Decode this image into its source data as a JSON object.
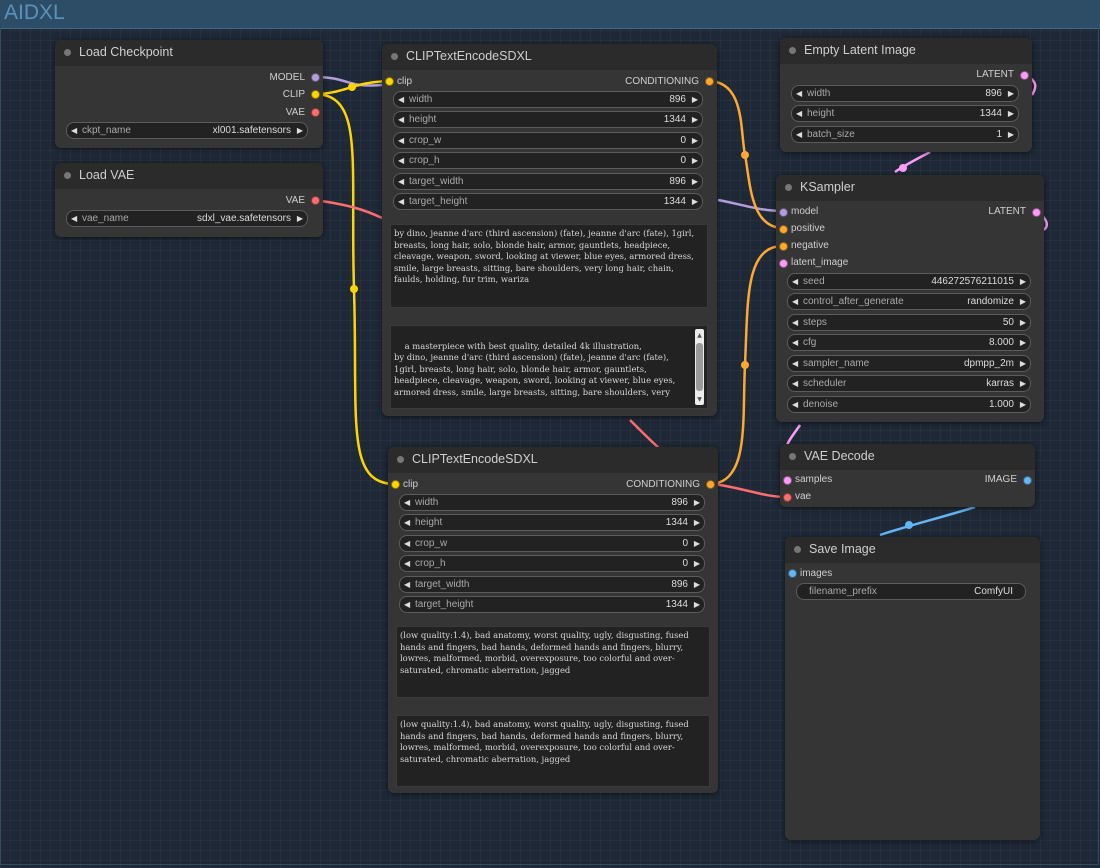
{
  "group": {
    "title": "AIDXL"
  },
  "colors": {
    "model": "#b39ddb",
    "clip": "#ffd500",
    "vae": "#ff6e6e",
    "conditioning": "#ffa931",
    "latent": "#ff9cf9",
    "image": "#64b5f6"
  },
  "load_checkpoint": {
    "title": "Load Checkpoint",
    "outputs": [
      "MODEL",
      "CLIP",
      "VAE"
    ],
    "widgets": [
      {
        "name": "ckpt_name",
        "value": "xl001.safetensors"
      }
    ]
  },
  "load_vae": {
    "title": "Load VAE",
    "outputs": [
      "VAE"
    ],
    "widgets": [
      {
        "name": "vae_name",
        "value": "sdxl_vae.safetensors"
      }
    ]
  },
  "clip_pos": {
    "title": "CLIPTextEncodeSDXL",
    "input": "clip",
    "output": "CONDITIONING",
    "widgets": [
      {
        "name": "width",
        "value": "896"
      },
      {
        "name": "height",
        "value": "1344"
      },
      {
        "name": "crop_w",
        "value": "0"
      },
      {
        "name": "crop_h",
        "value": "0"
      },
      {
        "name": "target_width",
        "value": "896"
      },
      {
        "name": "target_height",
        "value": "1344"
      }
    ],
    "text_g": "by dino, jeanne d'arc (third ascension) (fate), jeanne d'arc (fate), 1girl, breasts, long hair, solo, blonde hair, armor, gauntlets, headpiece, cleavage, weapon, sword, looking at viewer, blue eyes, armored dress, smile, large breasts, sitting, bare shoulders, very long hair, chain, faulds, holding, fur trim, wariza",
    "text_l": "a masterpiece with best quality, detailed 4k illustration,\nby dino, jeanne d'arc (third ascension) (fate), jeanne d'arc (fate), 1girl, breasts, long hair, solo, blonde hair, armor, gauntlets, headpiece, cleavage, weapon, sword, looking at viewer, blue eyes, armored dress, smile, large breasts, sitting, bare shoulders, very"
  },
  "clip_neg": {
    "title": "CLIPTextEncodeSDXL",
    "input": "clip",
    "output": "CONDITIONING",
    "widgets": [
      {
        "name": "width",
        "value": "896"
      },
      {
        "name": "height",
        "value": "1344"
      },
      {
        "name": "crop_w",
        "value": "0"
      },
      {
        "name": "crop_h",
        "value": "0"
      },
      {
        "name": "target_width",
        "value": "896"
      },
      {
        "name": "target_height",
        "value": "1344"
      }
    ],
    "text_g": "(low quality:1.4), bad anatomy, worst quality, ugly, disgusting, fused hands and fingers, bad hands, deformed hands and fingers, blurry, lowres, malformed, morbid, overexposure, too colorful and over-saturated, chromatic aberration, jagged",
    "text_l": "(low quality:1.4), bad anatomy, worst quality, ugly, disgusting, fused hands and fingers, bad hands, deformed hands and fingers, blurry, lowres, malformed, morbid, overexposure, too colorful and over-saturated, chromatic aberration, jagged"
  },
  "empty_latent": {
    "title": "Empty Latent Image",
    "output": "LATENT",
    "widgets": [
      {
        "name": "width",
        "value": "896"
      },
      {
        "name": "height",
        "value": "1344"
      },
      {
        "name": "batch_size",
        "value": "1"
      }
    ]
  },
  "ksampler": {
    "title": "KSampler",
    "inputs": [
      "model",
      "positive",
      "negative",
      "latent_image"
    ],
    "output": "LATENT",
    "widgets": [
      {
        "name": "seed",
        "value": "446272576211015"
      },
      {
        "name": "control_after_generate",
        "value": "randomize"
      },
      {
        "name": "steps",
        "value": "50"
      },
      {
        "name": "cfg",
        "value": "8.000"
      },
      {
        "name": "sampler_name",
        "value": "dpmpp_2m"
      },
      {
        "name": "scheduler",
        "value": "karras"
      },
      {
        "name": "denoise",
        "value": "1.000"
      }
    ]
  },
  "vae_decode": {
    "title": "VAE Decode",
    "inputs": [
      "samples",
      "vae"
    ],
    "output": "IMAGE"
  },
  "save_image": {
    "title": "Save Image",
    "input": "images",
    "widgets": [
      {
        "name": "filename_prefix",
        "value": "ComfyUI"
      }
    ]
  },
  "widget_arrows": {
    "left": "◀",
    "right": "▶"
  },
  "scroll_arrows": {
    "up": "▲",
    "down": "▼"
  }
}
